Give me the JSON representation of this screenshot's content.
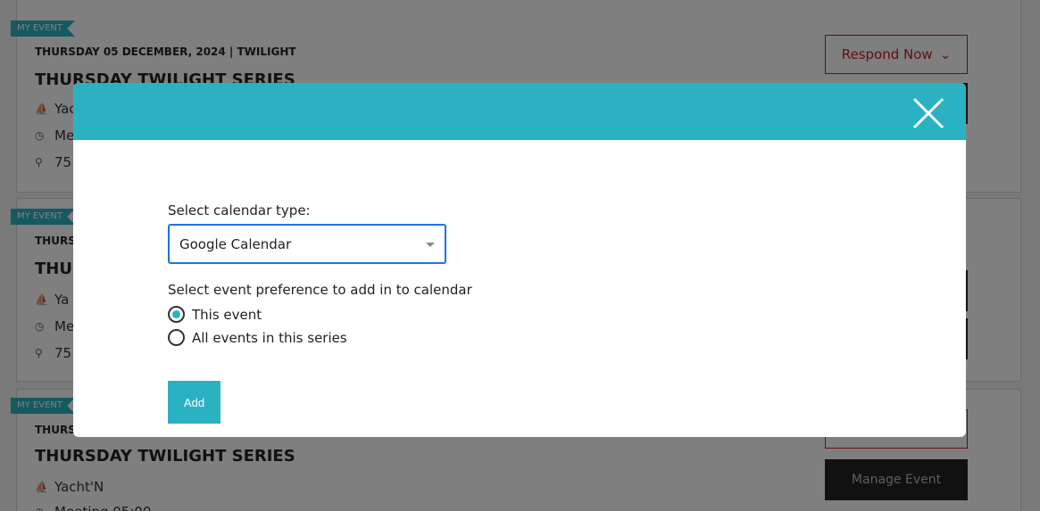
{
  "background": {
    "events": [
      {
        "ribbon": "MY EVENT",
        "date": "THURSDAY 05 DECEMBER, 2024 | TWILIGHT",
        "title": "THURSDAY TWILIGHT SERIES",
        "lines": [
          "Yac",
          "Me",
          "75"
        ],
        "respond_label": "Respond Now"
      },
      {
        "ribbon": "MY EVENT",
        "date": "THURSI",
        "title": "THU",
        "lines": [
          "Ya",
          "Me",
          "75"
        ]
      },
      {
        "ribbon": "MY EVENT",
        "date": "THURSI",
        "title": "THURSDAY TWILIGHT SERIES",
        "lines": [
          "Yacht'N",
          "Meeting 05:00"
        ],
        "manage_label": "Manage Event"
      }
    ]
  },
  "modal": {
    "header_color": "#2bb2c2",
    "close_icon": "close-icon",
    "calendar_type_label": "Select calendar type:",
    "calendar_type_value": "Google Calendar",
    "preference_label": "Select event preference to add in to calendar",
    "options": [
      {
        "label": "This event",
        "selected": true
      },
      {
        "label": "All events in this series",
        "selected": false
      }
    ],
    "add_label": "Add"
  }
}
